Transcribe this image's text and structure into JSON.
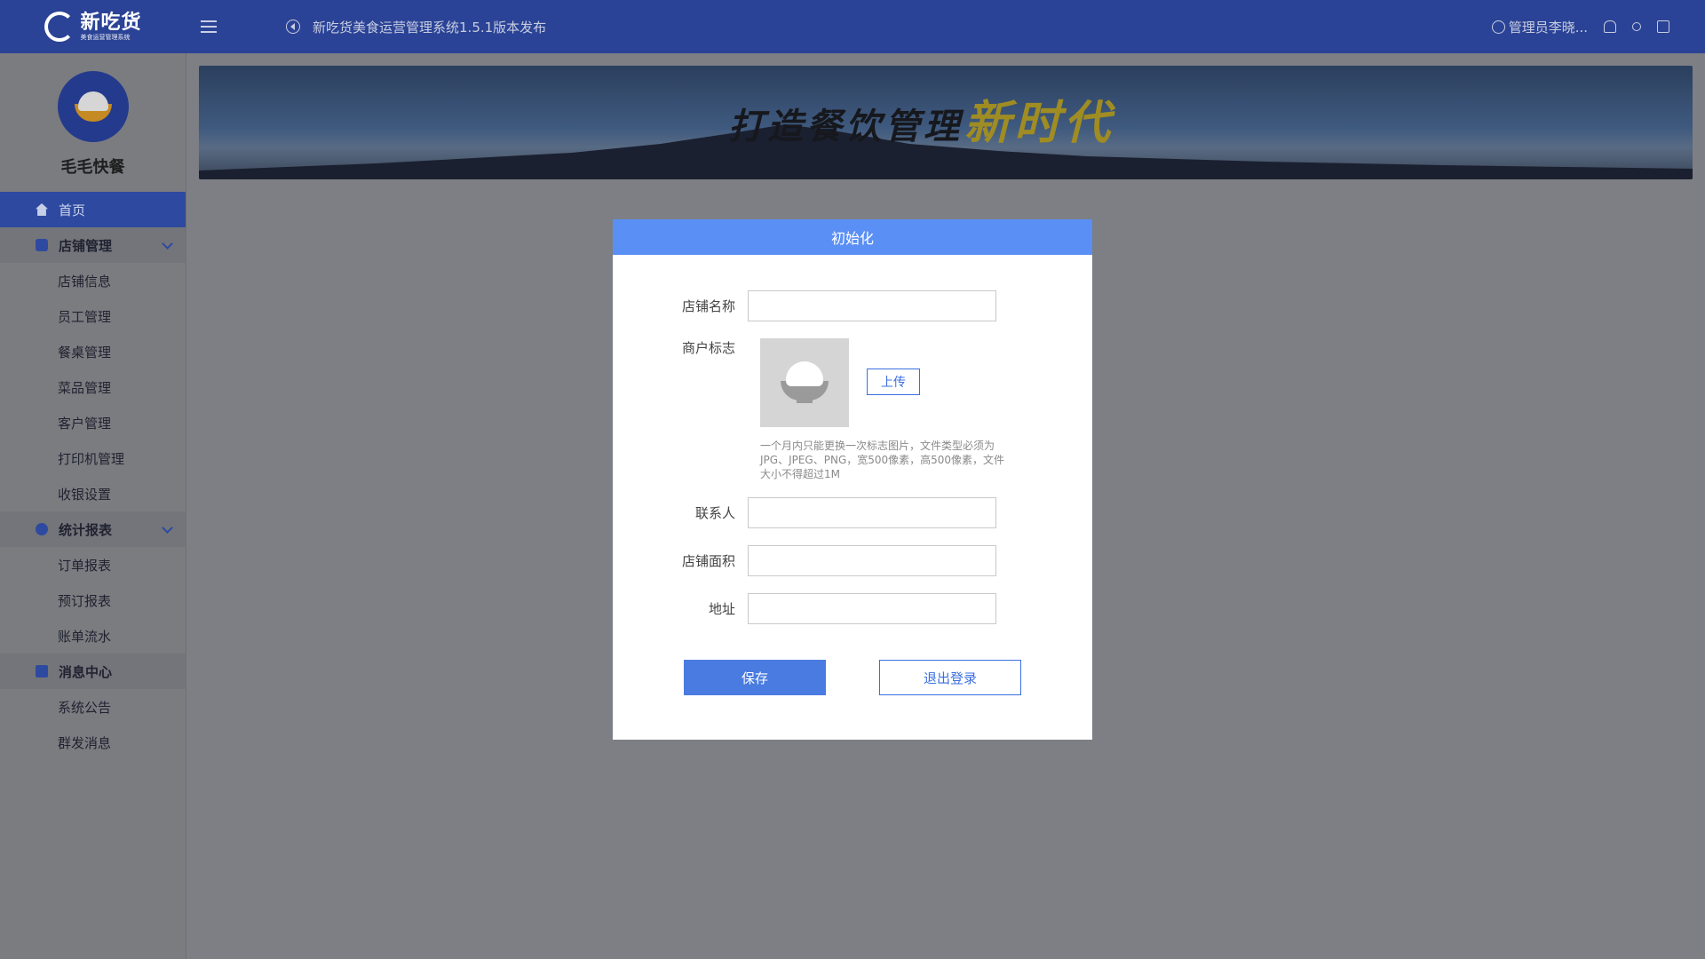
{
  "brand": {
    "name": "新吃货",
    "subtitle": "美食运营管理系统"
  },
  "header": {
    "announcement": "新吃货美食运营管理系统1.5.1版本发布",
    "user": "管理员李晓..."
  },
  "sidebar": {
    "shop_name": "毛毛快餐",
    "home": "首页",
    "store_group": "店铺管理",
    "store_items": [
      "店铺信息",
      "员工管理",
      "餐桌管理",
      "菜品管理",
      "客户管理",
      "打印机管理",
      "收银设置"
    ],
    "stats_group": "统计报表",
    "stats_items": [
      "订单报表",
      "预订报表",
      "账单流水"
    ],
    "msg_group": "消息中心",
    "msg_items": [
      "系统公告",
      "群发消息"
    ]
  },
  "banner": {
    "text_main": "打造餐饮管理",
    "text_accent": "新时代"
  },
  "modal": {
    "title": "初始化",
    "shop_name_label": "店铺名称",
    "shop_name_value": "",
    "logo_label": "商户标志",
    "upload_label": "上传",
    "hint": "一个月内只能更换一次标志图片，文件类型必须为JPG、JPEG、PNG，宽500像素，高500像素，文件大小不得超过1M",
    "contact_label": "联系人",
    "contact_value": "",
    "area_label": "店铺面积",
    "area_value": "",
    "address_label": "地址",
    "address_value": "",
    "save_label": "保存",
    "logout_label": "退出登录"
  },
  "colors": {
    "header": "#2b4396",
    "accent": "#4a7be0",
    "modal_header": "#5a8ff5",
    "banner_accent": "#9f8c23"
  }
}
